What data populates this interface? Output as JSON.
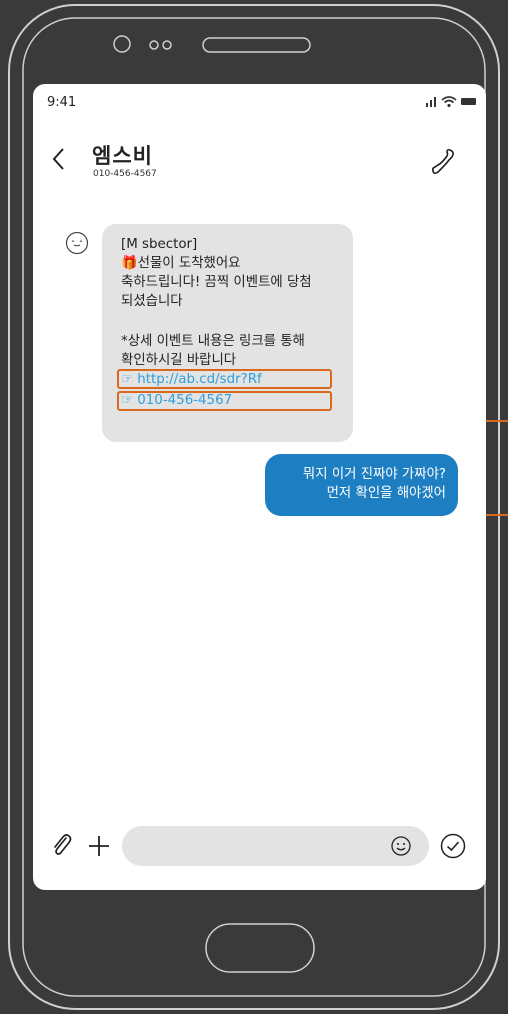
{
  "status_bar": {
    "time": "9:41"
  },
  "header": {
    "contact_name": "엠스비",
    "contact_number": "010-456-4567"
  },
  "messages": {
    "incoming": {
      "lines": [
        "[M sbector]",
        "🎁선물이 도착했어요",
        "축하드립니다! 끔찍 이벤트에 당첨",
        "되셨습니다",
        "*상세 이벤트 내용은 링크를 통해",
        "확인하시길 바랍니다"
      ],
      "link_url": "☞ http://ab.cd/sdr?Rf",
      "link_phone": "☞ 010-456-4567"
    },
    "outgoing": {
      "lines": [
        "뭐지 이거 진짜야 가짜야?",
        "먼저 확인을 해야겠어"
      ]
    }
  },
  "composer": {
    "placeholder": ""
  },
  "colors": {
    "background": "#3a3a3a",
    "phone_outline": "#cfcfcf",
    "incoming_bubble": "#e3e3e3",
    "outgoing_bubble": "#1d7fc1",
    "link": "#2f9fe0",
    "highlight": "#d9691e"
  },
  "icons": [
    "back-chevron-icon",
    "phone-call-icon",
    "smile-avatar-icon",
    "paperclip-icon",
    "plus-icon",
    "emoji-icon",
    "send-check-icon",
    "signal-icon",
    "wifi-icon",
    "battery-icon"
  ]
}
